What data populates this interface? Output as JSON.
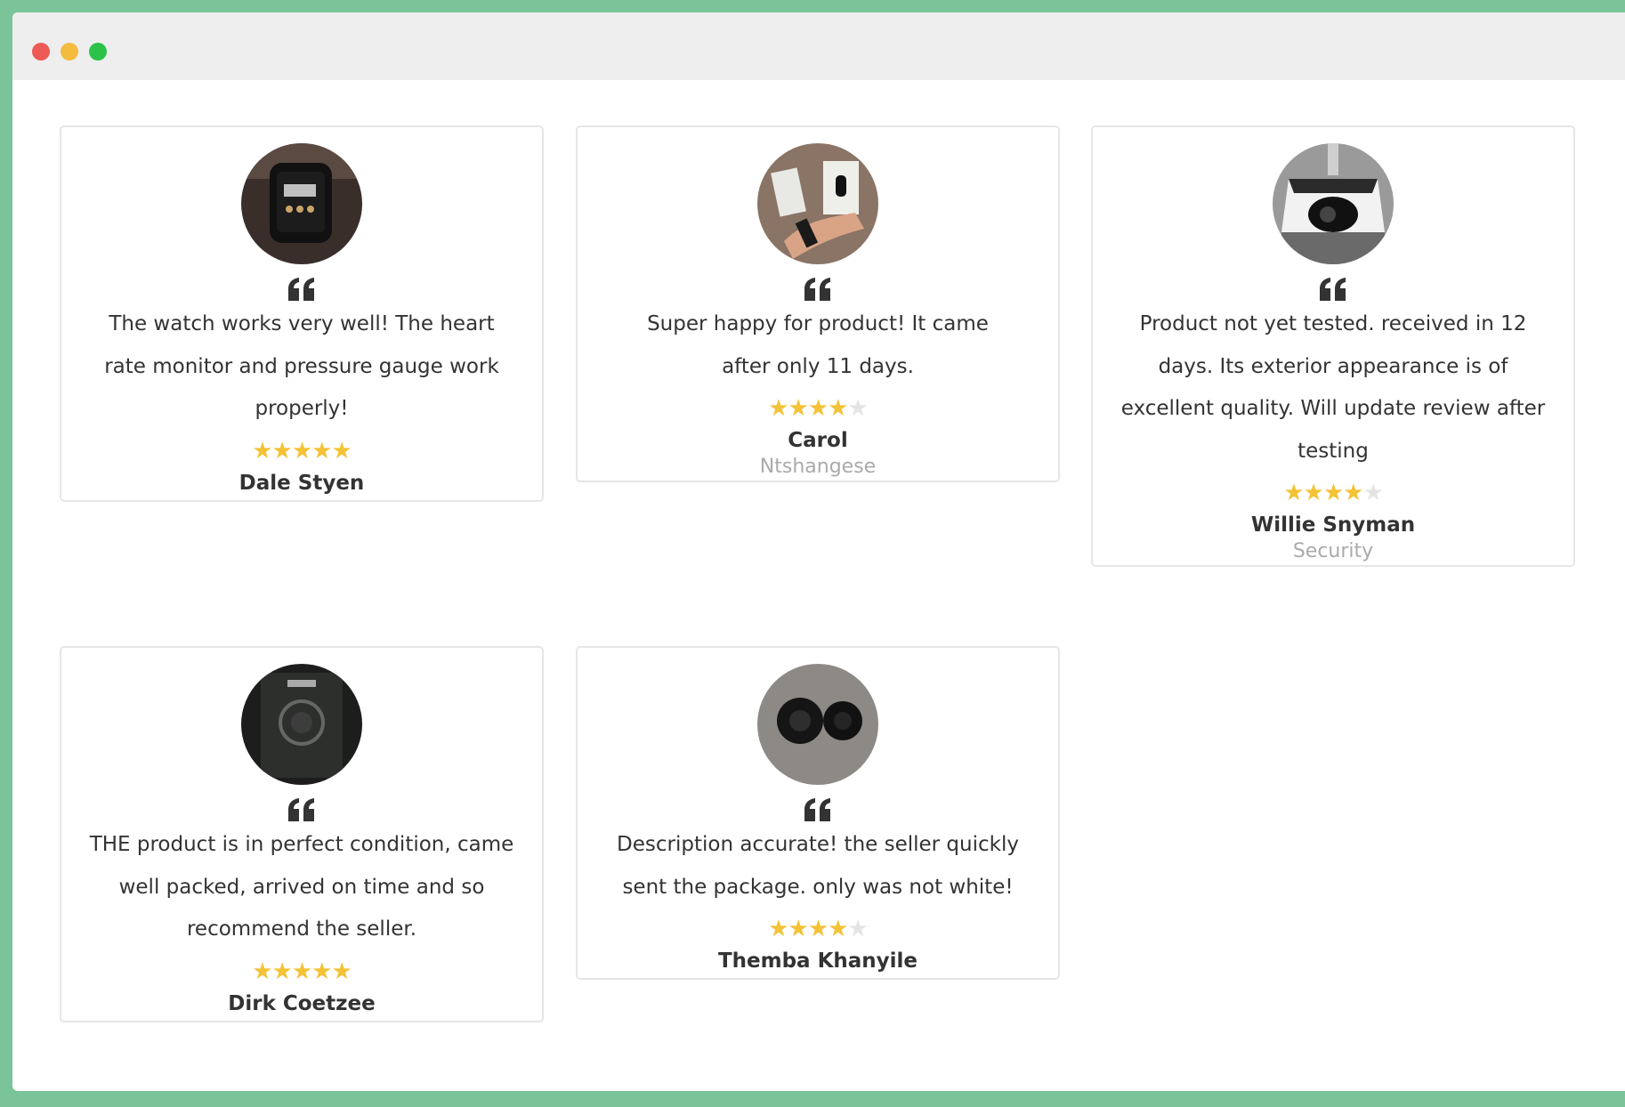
{
  "window": {
    "controls": [
      "close",
      "minimize",
      "maximize"
    ],
    "colors": {
      "close": "#ec5b56",
      "minimize": "#f3bc3f",
      "maximize": "#2bc24a",
      "background": "#7bc499",
      "star": "#f4c236"
    }
  },
  "reviews": [
    {
      "image": "smartwatch-photo",
      "text": "The watch works very well! The heart rate monitor and pressure gauge work properly!",
      "rating": 5,
      "name": "Dale Styen",
      "role": ""
    },
    {
      "image": "fitness-band-photo",
      "text": "Super happy for product! It came after only 11 days.",
      "rating": 4,
      "name": "Carol",
      "role": "Ntshangese"
    },
    {
      "image": "security-camera-photo",
      "text": "Product not yet tested. received in 12 days. Its exterior appearance is of excellent quality. Will update review after testing",
      "rating": 4,
      "name": "Willie Snyman",
      "role": "Security"
    },
    {
      "image": "boxed-watch-photo",
      "text": "THE product is in perfect condition, came well packed, arrived on time and so recommend the seller.",
      "rating": 5,
      "name": "Dirk Coetzee",
      "role": ""
    },
    {
      "image": "earbuds-photo",
      "text": "Description accurate! the seller quickly sent the package. only was not white!",
      "rating": 4,
      "name": "Themba Khanyile",
      "role": ""
    }
  ]
}
